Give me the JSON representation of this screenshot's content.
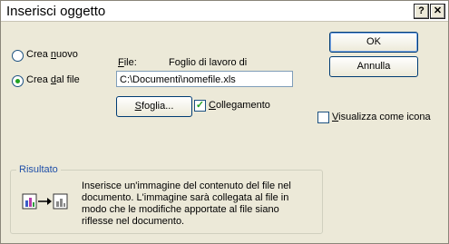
{
  "window": {
    "title": "Inserisci oggetto",
    "help_button": "?",
    "close_button": "✕"
  },
  "options": {
    "create_new": {
      "label": "Crea nuovo",
      "accel_index": 5,
      "selected": false
    },
    "create_from_file": {
      "label": "Crea dal file",
      "accel_index": 5,
      "selected": true
    }
  },
  "file": {
    "label": "File:",
    "type_label": "Foglio di lavoro di",
    "path_value": "C:\\Documenti\\nomefile.xls",
    "browse_button": "Sfoglia...",
    "link_checkbox": {
      "label": "Collegamento",
      "checked": true
    }
  },
  "buttons": {
    "ok": "OK",
    "cancel": "Annulla"
  },
  "display_as_icon": {
    "label": "Visualizza come icona",
    "checked": false
  },
  "result": {
    "group_label": "Risultato",
    "description": "Inserisce un'immagine del contenuto del file nel documento. L'immagine sarà collegata al file in modo che le modifiche apportate al file siano riflesse nel documento.",
    "icon": "linked-file-icon"
  },
  "colors": {
    "dialog_bg": "#ece9d8",
    "group_label": "#1f4fa8",
    "check_green": "#21a121"
  }
}
